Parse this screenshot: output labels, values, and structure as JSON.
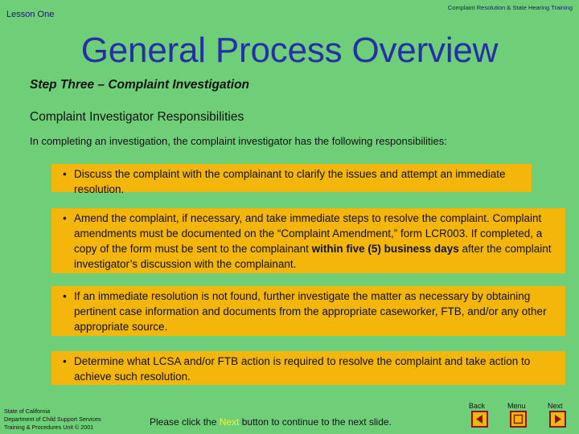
{
  "header": {
    "lesson": "Lesson One",
    "course": "Complaint Resolution & State Hearing Training"
  },
  "title": "General Process Overview",
  "step": "Step Three – Complaint Investigation",
  "subheading": "Complaint Investigator Responsibilities",
  "intro": "In completing an investigation, the complaint investigator has the following responsibilities:",
  "bullets": [
    "Discuss the complaint with the complainant to clarify the issues and attempt an immediate resolution.",
    {
      "before": "Amend the complaint, if necessary, and take immediate steps to resolve the complaint. Complaint amendments must be documented on the “Complaint Amendment,” form LCR003.  If completed, a copy of the form must be sent to the complainant ",
      "bold": "within five (5) business days",
      "after": " after the complaint investigator’s discussion with the complainant."
    },
    "If an immediate resolution is not found, further investigate the matter as necessary by obtaining pertinent case information and documents from the appropriate caseworker, FTB, and/or any other appropriate source.",
    "Determine what LCSA and/or FTB action is required to resolve the complaint and take action to achieve such resolution."
  ],
  "footer": {
    "org_line1": "State of California",
    "org_line2": "Department of Child Support Services",
    "org_line3": "Training & Procedures Unit  © 2001",
    "cta_before": "Please click the ",
    "cta_link": "Next",
    "cta_after": " button to continue to the next slide."
  },
  "nav": {
    "back": "Back",
    "menu": "Menu",
    "next": "Next"
  },
  "colors": {
    "background": "#6fcf79",
    "title": "#2530a8",
    "box": "#f4b60b",
    "button_border": "#8a1616"
  }
}
